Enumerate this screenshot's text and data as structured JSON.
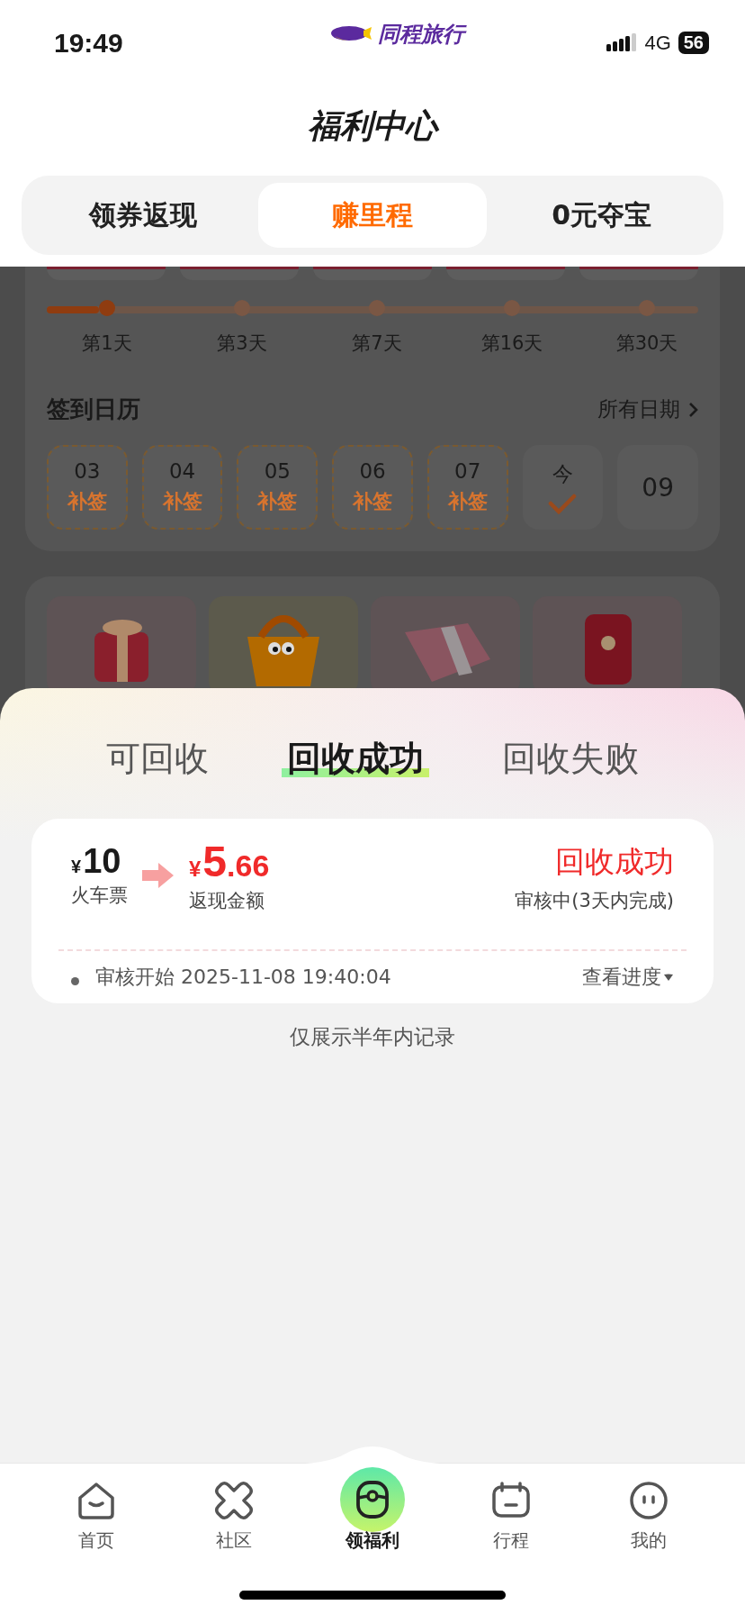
{
  "status_bar": {
    "time": "19:49",
    "app_name": "同程旅行",
    "network": "4G",
    "battery": "56"
  },
  "header": {
    "title": "福利中心"
  },
  "tabs": [
    {
      "label": "领券返现",
      "selected": false
    },
    {
      "label": "赚里程",
      "selected": true
    },
    {
      "label": "0元夺宝",
      "selected": false
    }
  ],
  "progress": {
    "level": 0.08,
    "milestones": [
      {
        "label": "第1天",
        "reached": true
      },
      {
        "label": "第3天",
        "reached": false
      },
      {
        "label": "第7天",
        "reached": false
      },
      {
        "label": "第16天",
        "reached": false
      },
      {
        "label": "第30天",
        "reached": false
      }
    ]
  },
  "calendar": {
    "title": "签到日历",
    "link": "所有日期",
    "days": [
      {
        "kind": "makeup",
        "date": "03",
        "action": "补签"
      },
      {
        "kind": "makeup",
        "date": "04",
        "action": "补签"
      },
      {
        "kind": "makeup",
        "date": "05",
        "action": "补签"
      },
      {
        "kind": "makeup",
        "date": "06",
        "action": "补签"
      },
      {
        "kind": "makeup",
        "date": "07",
        "action": "补签"
      },
      {
        "kind": "today",
        "date": "今"
      },
      {
        "kind": "future",
        "date": "09"
      }
    ]
  },
  "rewards": [
    {
      "kind": "gift"
    },
    {
      "kind": "basket"
    },
    {
      "kind": "cash"
    },
    {
      "kind": "envelope"
    }
  ],
  "sheet": {
    "tabs": [
      {
        "label": "可回收",
        "selected": false
      },
      {
        "label": "回收成功",
        "selected": true
      },
      {
        "label": "回收失败",
        "selected": false
      }
    ],
    "records": [
      {
        "original": {
          "currency": "¥",
          "amount": "10",
          "label": "火车票"
        },
        "cashback": {
          "currency": "¥",
          "whole": "5",
          "fraction": ".66",
          "label": "返现金额"
        },
        "status": "回收成功",
        "note": "审核中(3天内完成)",
        "event": "审核开始",
        "time": "2025-11-08 19:40:04",
        "link": "查看进度"
      }
    ],
    "footer": "仅展示半年内记录"
  },
  "nav": [
    {
      "label": "首页",
      "selected": false
    },
    {
      "label": "社区",
      "selected": false
    },
    {
      "label": "领福利",
      "selected": true
    },
    {
      "label": "行程",
      "selected": false
    },
    {
      "label": "我的",
      "selected": false
    }
  ]
}
